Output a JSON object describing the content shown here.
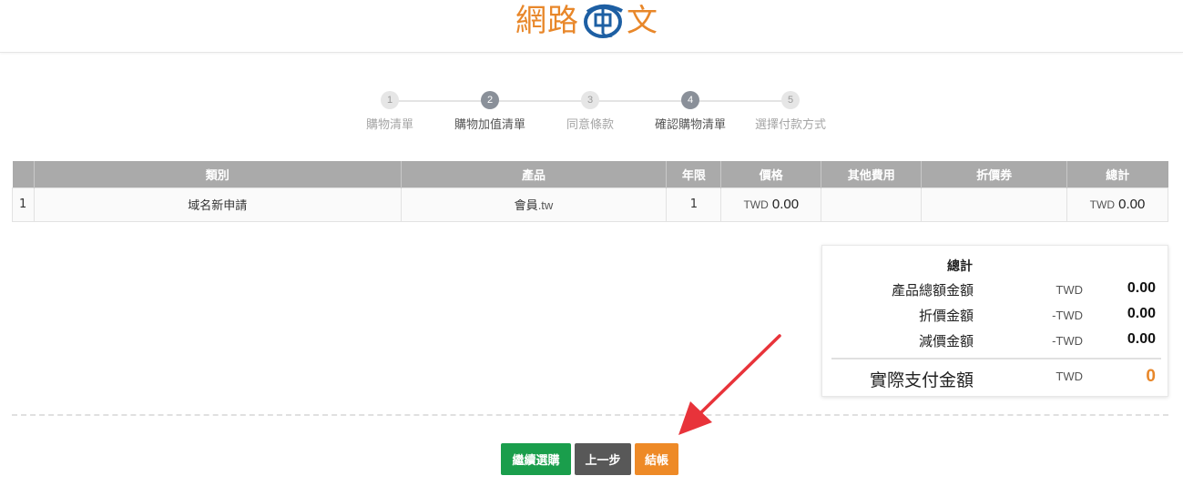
{
  "header": {
    "logo_left": "網路",
    "logo_right": "文",
    "logo_icon": "globe-chinese-logo"
  },
  "steps": [
    {
      "num": "1",
      "label": "購物清單",
      "active": false
    },
    {
      "num": "2",
      "label": "購物加值清單",
      "active": true
    },
    {
      "num": "3",
      "label": "同意條款",
      "active": false
    },
    {
      "num": "4",
      "label": "確認購物清單",
      "active": true
    },
    {
      "num": "5",
      "label": "選擇付款方式",
      "active": false
    }
  ],
  "table": {
    "headers": [
      "",
      "類別",
      "產品",
      "年限",
      "價格",
      "其他費用",
      "折價券",
      "總計"
    ],
    "rows": [
      {
        "idx": "1",
        "category": "域名新申請",
        "product_name": "會員",
        "product_tld": ".tw",
        "years": "1",
        "price_currency": "TWD",
        "price_amount": "0.00",
        "other_fees": "",
        "coupon": "",
        "total_currency": "TWD",
        "total_amount": "0.00"
      }
    ]
  },
  "summary": {
    "title": "總計",
    "rows": [
      {
        "label": "產品總額金額",
        "currency": "TWD",
        "value": "0.00"
      },
      {
        "label": "折價金額",
        "currency": "-TWD",
        "value": "0.00"
      },
      {
        "label": "減價金額",
        "currency": "-TWD",
        "value": "0.00"
      }
    ],
    "total": {
      "label": "實際支付金額",
      "currency": "TWD",
      "value": "0"
    }
  },
  "buttons": {
    "continue_label": "繼續選購",
    "back_label": "上一步",
    "checkout_label": "結帳"
  },
  "colors": {
    "accent": "#ee8a27",
    "green": "#1a9e4c",
    "gray": "#585858",
    "header_gray": "#aaaaaa",
    "arrow": "#e8333a"
  }
}
